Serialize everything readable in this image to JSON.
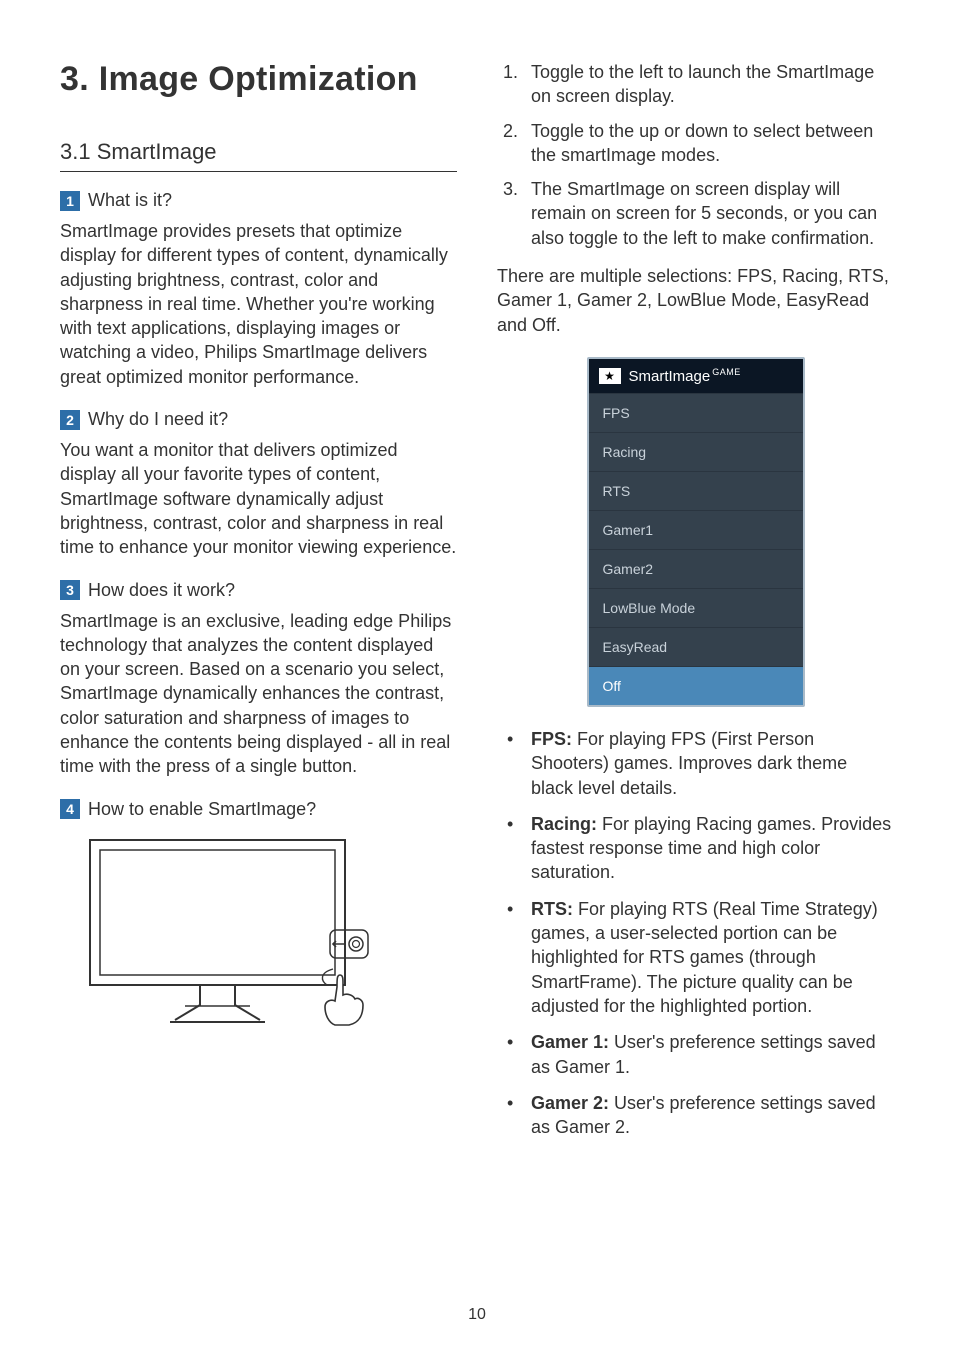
{
  "chapter": {
    "number": "3.",
    "title": "Image Optimization"
  },
  "section": {
    "number": "3.1",
    "title": "SmartImage"
  },
  "q1": {
    "num": "1",
    "label": "What is it?",
    "body": "SmartImage provides presets that optimize display for different types of content, dynamically adjusting brightness, contrast, color and sharpness in real time. Whether you're working with text applications, displaying images or watching a video, Philips SmartImage delivers great optimized monitor performance."
  },
  "q2": {
    "num": "2",
    "label": "Why do I need it?",
    "body": "You want a monitor that delivers optimized display all your favorite types of content, SmartImage software dynamically adjust brightness, contrast, color and sharpness in real time to enhance your monitor viewing experience."
  },
  "q3": {
    "num": "3",
    "label": "How does it work?",
    "body": "SmartImage is an exclusive, leading edge Philips technology that analyzes the content displayed on your screen. Based on a scenario you select, SmartImage dynamically enhances the contrast, color saturation and sharpness of images to enhance the contents being displayed - all in real time with the press of a single button."
  },
  "q4": {
    "num": "4",
    "label": "How to enable SmartImage?"
  },
  "steps": {
    "s1": "Toggle to the left to launch the SmartImage on screen display.",
    "s2": "Toggle to the up or down to select between the smartImage modes.",
    "s3": "The SmartImage on screen display will remain on screen for 5 seconds, or you can also toggle to the left to make confirmation."
  },
  "selections_intro": "There are multiple selections: FPS, Racing, RTS, Gamer 1, Gamer 2, LowBlue Mode, EasyRead and Off.",
  "osd": {
    "title": "SmartImage",
    "title_sup": "GAME",
    "items": [
      "FPS",
      "Racing",
      "RTS",
      "Gamer1",
      "Gamer2",
      "LowBlue Mode",
      "EasyRead",
      "Off"
    ],
    "selected_index": 7
  },
  "modes": {
    "fps": {
      "label": "FPS:",
      "desc": " For playing FPS (First Person Shooters) games. Improves dark theme black level details."
    },
    "racing": {
      "label": "Racing:",
      "desc": " For playing Racing games. Provides fastest response time and high color saturation."
    },
    "rts": {
      "label": "RTS:",
      "desc": " For playing RTS (Real Time Strategy) games, a user-selected portion can be highlighted for RTS games (through SmartFrame). The picture quality can be adjusted for the highlighted portion."
    },
    "g1": {
      "label": "Gamer 1:",
      "desc": " User's preference settings saved as Gamer 1."
    },
    "g2": {
      "label": "Gamer 2:",
      "desc": " User's preference settings saved as Gamer 2."
    }
  },
  "page_number": "10"
}
